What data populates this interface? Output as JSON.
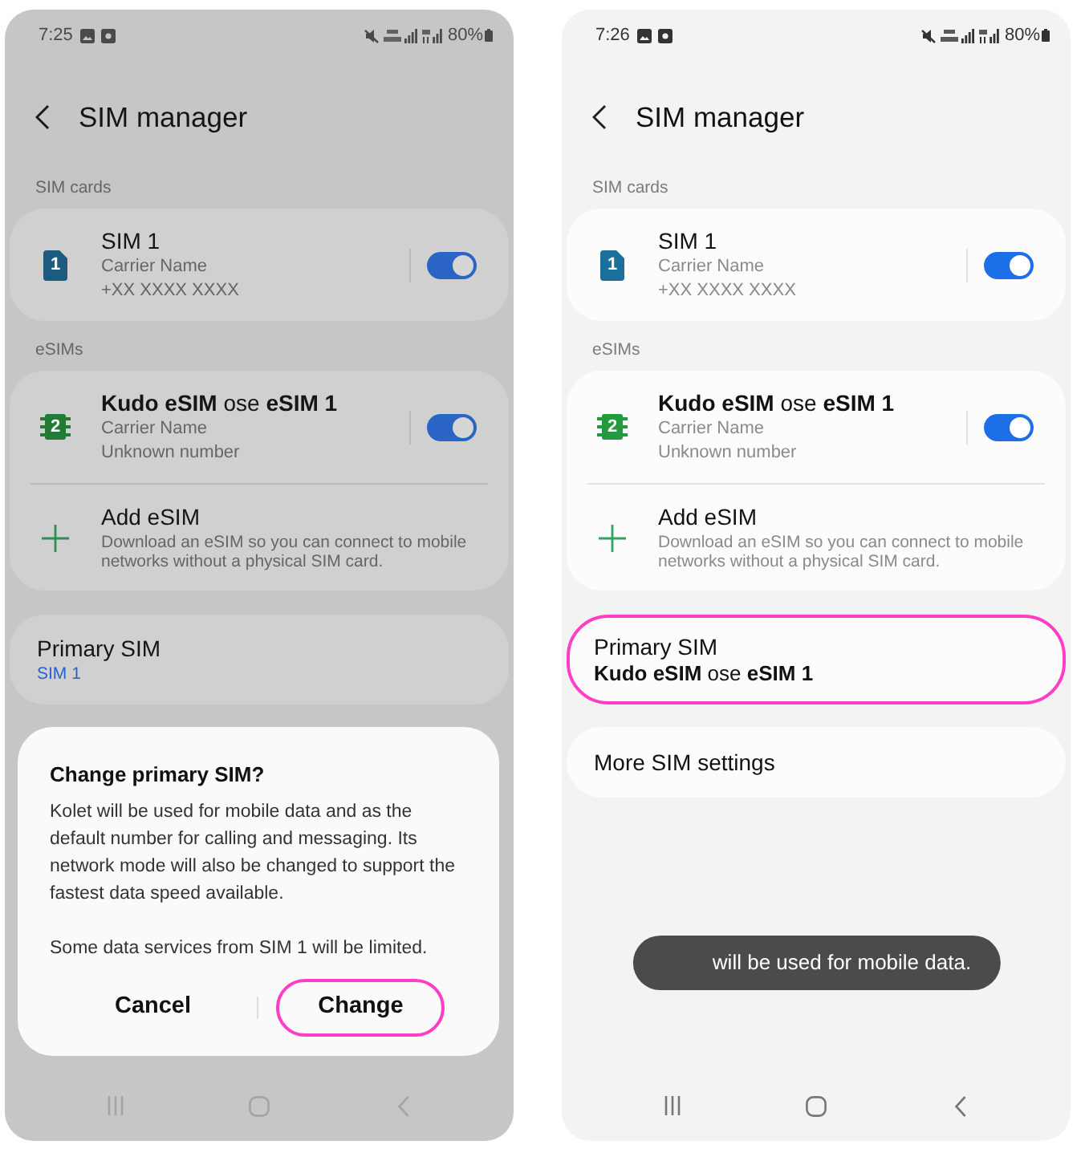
{
  "screens": [
    {
      "dimmed": true,
      "status_bar": {
        "time": "7:25",
        "battery": "80%"
      },
      "header": {
        "title": "SIM manager"
      },
      "sections": [
        {
          "label": "SIM cards",
          "items": [
            {
              "kind": "sim",
              "slot": "1",
              "title": "SIM 1",
              "lines": [
                "Carrier Name",
                "+XX XXXX XXXX"
              ],
              "on": true
            }
          ]
        },
        {
          "label": "eSIMs",
          "items": [
            {
              "kind": "esim",
              "slot": "2",
              "title": "**Kudo eSIM** ose **eSIM 1**",
              "lines": [
                "Carrier Name",
                "Unknown number"
              ],
              "on": true
            },
            {
              "kind": "add",
              "title": "Add eSIM",
              "lines": [
                "Download an eSIM so you can connect to mobile networks without a physical SIM card."
              ]
            }
          ]
        }
      ],
      "settings": [
        {
          "kind": "summary",
          "title": "Primary SIM",
          "value": "SIM 1",
          "highlighted": false
        }
      ],
      "dialog": {
        "title": "Change primary SIM?",
        "paragraphs": [
          "Kolet will be used for mobile data and as the default number for calling and messaging. Its network mode will also be changed to support the fastest data speed available.",
          "Some data services from SIM 1 will be limited."
        ],
        "buttons": [
          {
            "label": "Cancel",
            "highlighted": false
          },
          {
            "label": "Change",
            "highlighted": true
          }
        ]
      }
    },
    {
      "dimmed": false,
      "status_bar": {
        "time": "7:26",
        "battery": "80%"
      },
      "header": {
        "title": "SIM manager"
      },
      "sections": [
        {
          "label": "SIM cards",
          "items": [
            {
              "kind": "sim",
              "slot": "1",
              "title": "SIM 1",
              "lines": [
                "Carrier Name",
                "+XX XXXX XXXX"
              ],
              "on": true
            }
          ]
        },
        {
          "label": "eSIMs",
          "items": [
            {
              "kind": "esim",
              "slot": "2",
              "title": "**Kudo eSIM** ose **eSIM 1**",
              "lines": [
                "Carrier Name",
                "Unknown number"
              ],
              "on": true
            },
            {
              "kind": "add",
              "title": "Add eSIM",
              "lines": [
                "Download an eSIM so you can connect to mobile networks without a physical SIM card."
              ]
            }
          ]
        }
      ],
      "settings": [
        {
          "kind": "plain",
          "title": "Primary SIM",
          "value": "**Kudo eSIM** ose **eSIM 1**",
          "highlighted": true
        },
        {
          "kind": "link",
          "title": "More SIM settings",
          "highlighted": false
        }
      ],
      "toast": {
        "text": "will be used for mobile data."
      }
    }
  ]
}
